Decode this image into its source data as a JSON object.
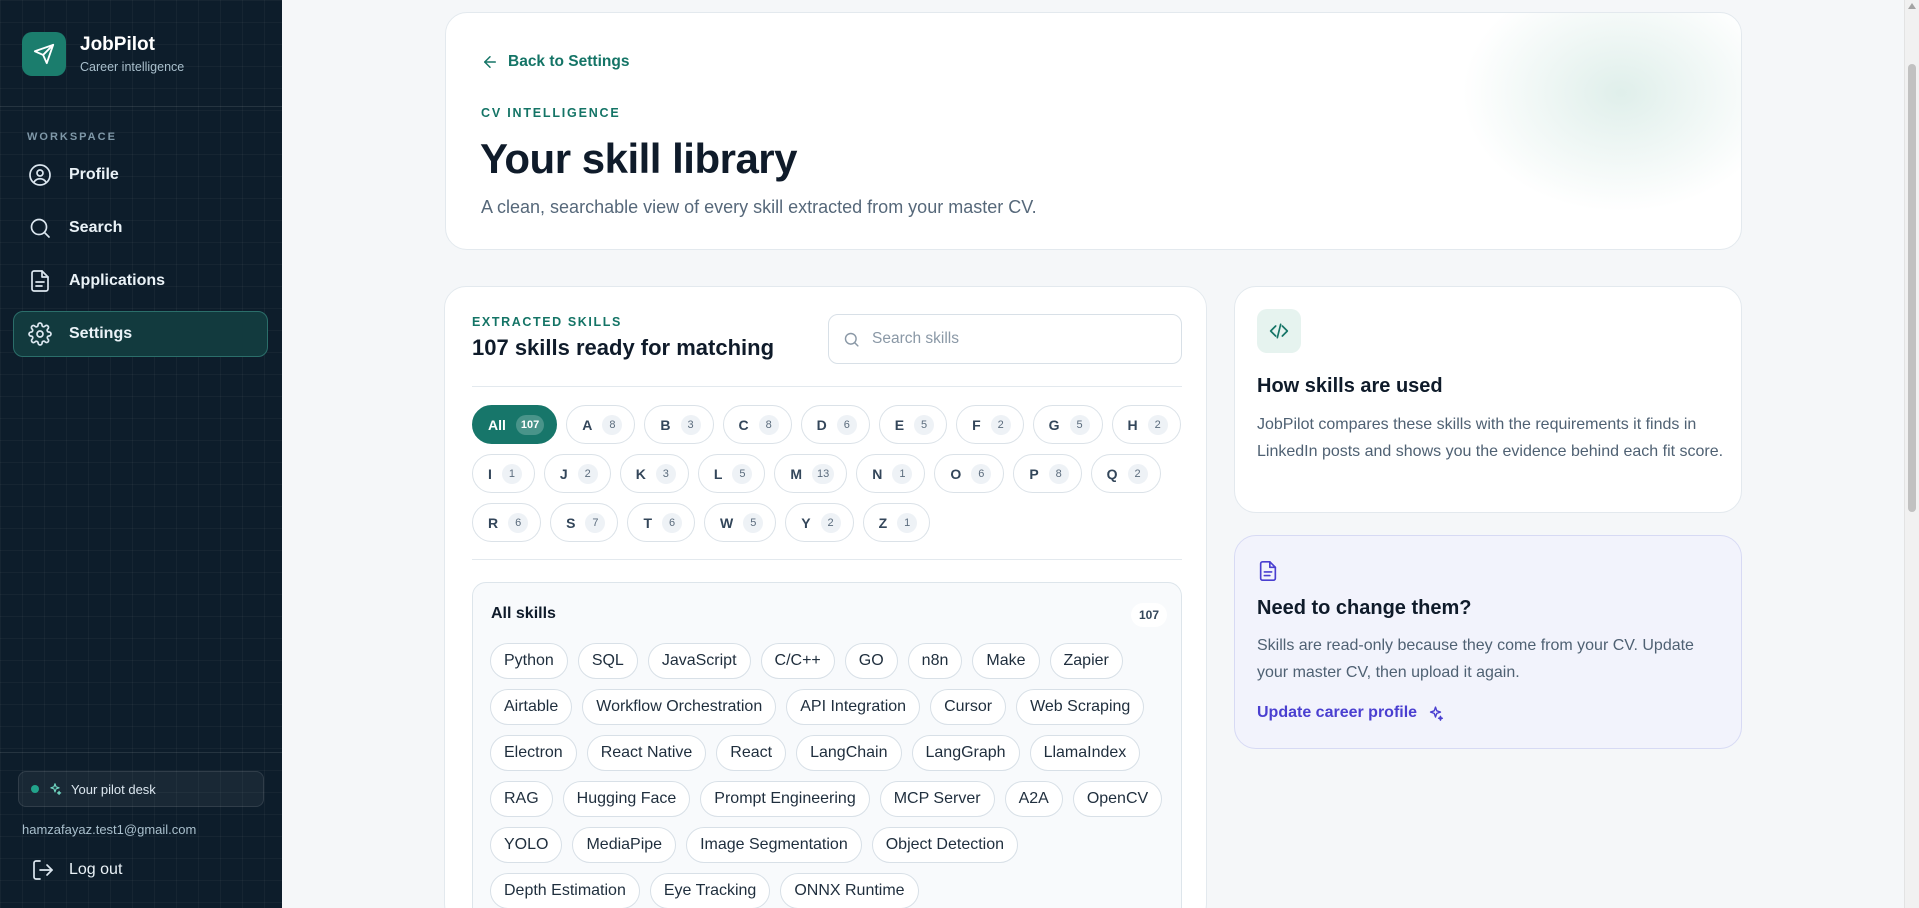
{
  "brand": {
    "name": "JobPilot",
    "subtitle": "Career intelligence",
    "logo_icon": "paper-plane-icon"
  },
  "sidebar": {
    "section_label": "WORKSPACE",
    "items": [
      {
        "label": "Profile",
        "icon": "user-circle-icon",
        "active": false
      },
      {
        "label": "Search",
        "icon": "search-icon",
        "active": false
      },
      {
        "label": "Applications",
        "icon": "document-icon",
        "active": false
      },
      {
        "label": "Settings",
        "icon": "gear-icon",
        "active": true
      }
    ],
    "pilot_desk": "Your pilot desk",
    "email": "hamzafayaz.test1@gmail.com",
    "logout_label": "Log out"
  },
  "hero": {
    "back_label": "Back to Settings",
    "eyebrow": "CV INTELLIGENCE",
    "title": "Your skill library",
    "subtitle": "A clean, searchable view of every skill extracted from your master CV."
  },
  "skills": {
    "eyebrow": "EXTRACTED SKILLS",
    "title": "107 skills ready for matching",
    "search_placeholder": "Search skills",
    "search_value": "",
    "filters": [
      {
        "label": "All",
        "count": "107",
        "active": true
      },
      {
        "label": "A",
        "count": "8"
      },
      {
        "label": "B",
        "count": "3"
      },
      {
        "label": "C",
        "count": "8"
      },
      {
        "label": "D",
        "count": "6"
      },
      {
        "label": "E",
        "count": "5"
      },
      {
        "label": "F",
        "count": "2"
      },
      {
        "label": "G",
        "count": "5"
      },
      {
        "label": "H",
        "count": "2"
      },
      {
        "label": "I",
        "count": "1"
      },
      {
        "label": "J",
        "count": "2"
      },
      {
        "label": "K",
        "count": "3"
      },
      {
        "label": "L",
        "count": "5"
      },
      {
        "label": "M",
        "count": "13"
      },
      {
        "label": "N",
        "count": "1"
      },
      {
        "label": "O",
        "count": "6"
      },
      {
        "label": "P",
        "count": "8"
      },
      {
        "label": "Q",
        "count": "2"
      },
      {
        "label": "R",
        "count": "6"
      },
      {
        "label": "S",
        "count": "7"
      },
      {
        "label": "T",
        "count": "6"
      },
      {
        "label": "W",
        "count": "5"
      },
      {
        "label": "Y",
        "count": "2"
      },
      {
        "label": "Z",
        "count": "1"
      }
    ],
    "list_title": "All skills",
    "list_count": "107",
    "items": [
      "Python",
      "SQL",
      "JavaScript",
      "C/C++",
      "GO",
      "n8n",
      "Make",
      "Zapier",
      "Airtable",
      "Workflow Orchestration",
      "API Integration",
      "Cursor",
      "Web Scraping",
      "Electron",
      "React Native",
      "React",
      "LangChain",
      "LangGraph",
      "LlamaIndex",
      "RAG",
      "Hugging Face",
      "Prompt Engineering",
      "MCP Server",
      "A2A",
      "OpenCV",
      "YOLO",
      "MediaPipe",
      "Image Segmentation",
      "Object Detection",
      "Depth Estimation",
      "Eye Tracking",
      "ONNX Runtime"
    ]
  },
  "how": {
    "icon": "code-icon",
    "title": "How skills are used",
    "body": "JobPilot compares these skills with the requirements it finds in LinkedIn posts and shows you the evidence behind each fit score."
  },
  "change": {
    "icon": "document-icon",
    "title": "Need to change them?",
    "body": "Skills are read-only because they come from your CV. Update your master CV, then upload it again.",
    "link_label": "Update career profile",
    "link_icon": "sparkle-icon"
  },
  "colors": {
    "accent": "#17766a",
    "sidebar_bg": "#0d1d2b",
    "link_purple": "#4a3fd0"
  }
}
